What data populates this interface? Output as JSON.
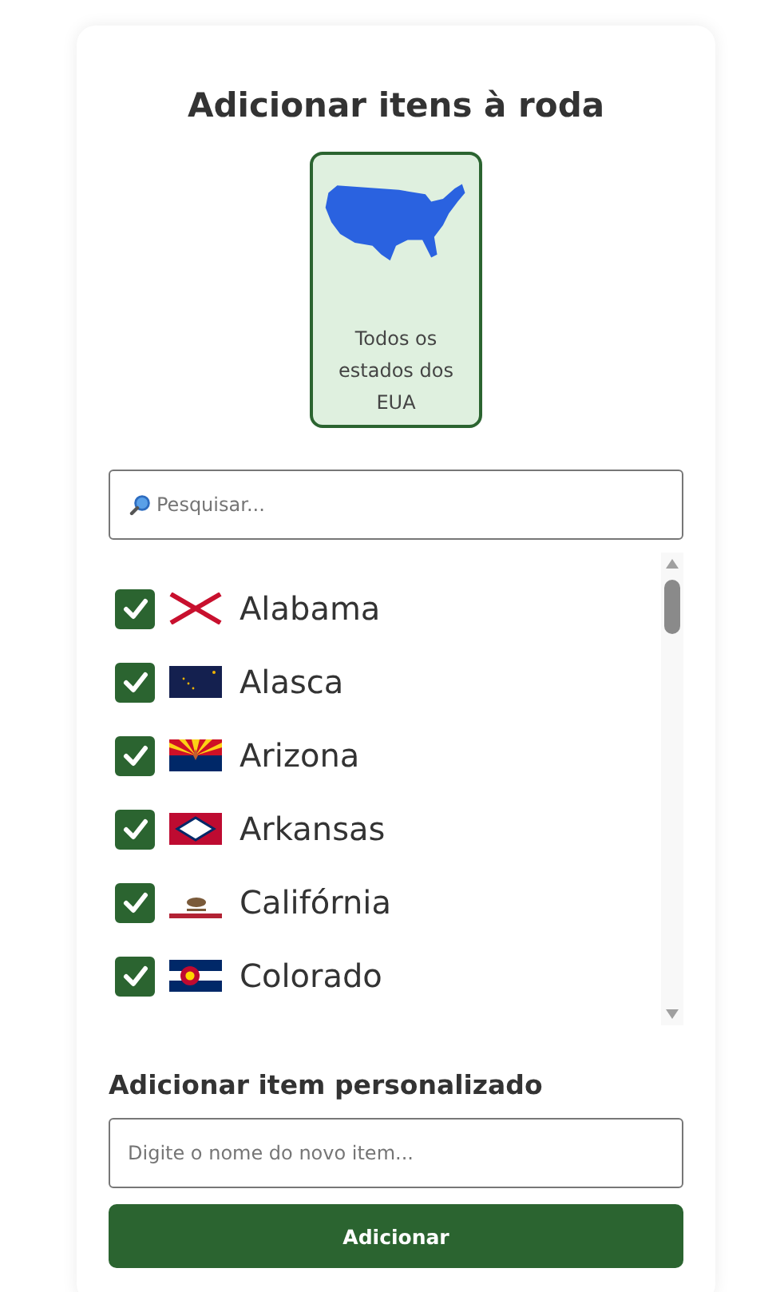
{
  "title": "Adicionar itens à roda",
  "category": {
    "label": "Todos os estados dos EUA",
    "selected": true
  },
  "search": {
    "placeholder": "Pesquisar..."
  },
  "items": [
    {
      "name": "Alabama",
      "checked": true,
      "kind": "alabama"
    },
    {
      "name": "Alasca",
      "checked": true,
      "kind": "alaska"
    },
    {
      "name": "Arizona",
      "checked": true,
      "kind": "arizona"
    },
    {
      "name": "Arkansas",
      "checked": true,
      "kind": "arkansas"
    },
    {
      "name": "Califórnia",
      "checked": true,
      "kind": "california"
    },
    {
      "name": "Colorado",
      "checked": true,
      "kind": "colorado"
    }
  ],
  "custom": {
    "heading": "Adicionar item personalizado",
    "placeholder": "Digite o nome do novo item...",
    "button": "Adicionar"
  }
}
